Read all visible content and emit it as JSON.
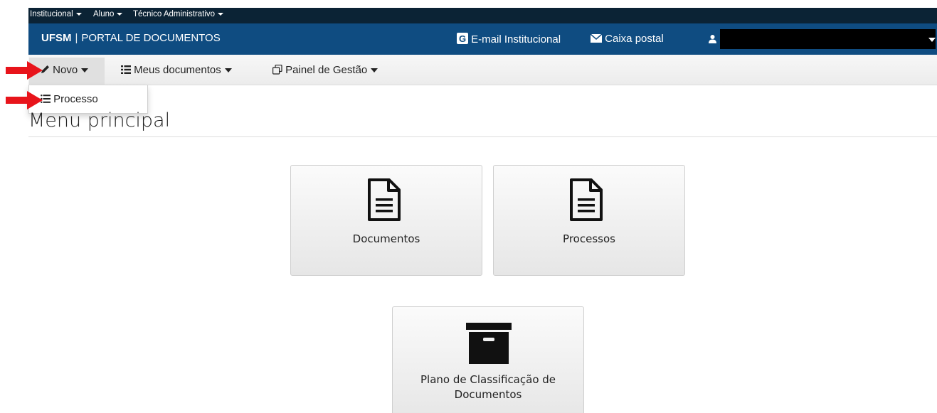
{
  "topbar": {
    "items": [
      {
        "label": "Institucional"
      },
      {
        "label": "Aluno"
      },
      {
        "label": "Técnico Administrativo"
      }
    ]
  },
  "header": {
    "brand_bold": "UFSM",
    "brand_separator": "|",
    "brand_rest": "PORTAL DE DOCUMENTOS",
    "email_label": "E-mail Institucional",
    "mail_label": "Caixa postal",
    "user_name": ""
  },
  "navbar": {
    "novo": "Novo",
    "meus_documentos": "Meus documentos",
    "painel": "Painel de Gestão"
  },
  "dropdown": {
    "items": [
      {
        "label": "Processo"
      }
    ]
  },
  "main": {
    "title": "Menu principal",
    "tiles": [
      {
        "label": "Documentos",
        "icon": "document-icon"
      },
      {
        "label": "Processos",
        "icon": "document-icon"
      },
      {
        "label_line1": "Plano de Classificação de",
        "label_line2": "Documentos",
        "icon": "archive-box-icon"
      }
    ]
  },
  "colors": {
    "topbar": "#0b2335",
    "header": "#0f4c81",
    "annotation_arrow": "#e8141b"
  }
}
